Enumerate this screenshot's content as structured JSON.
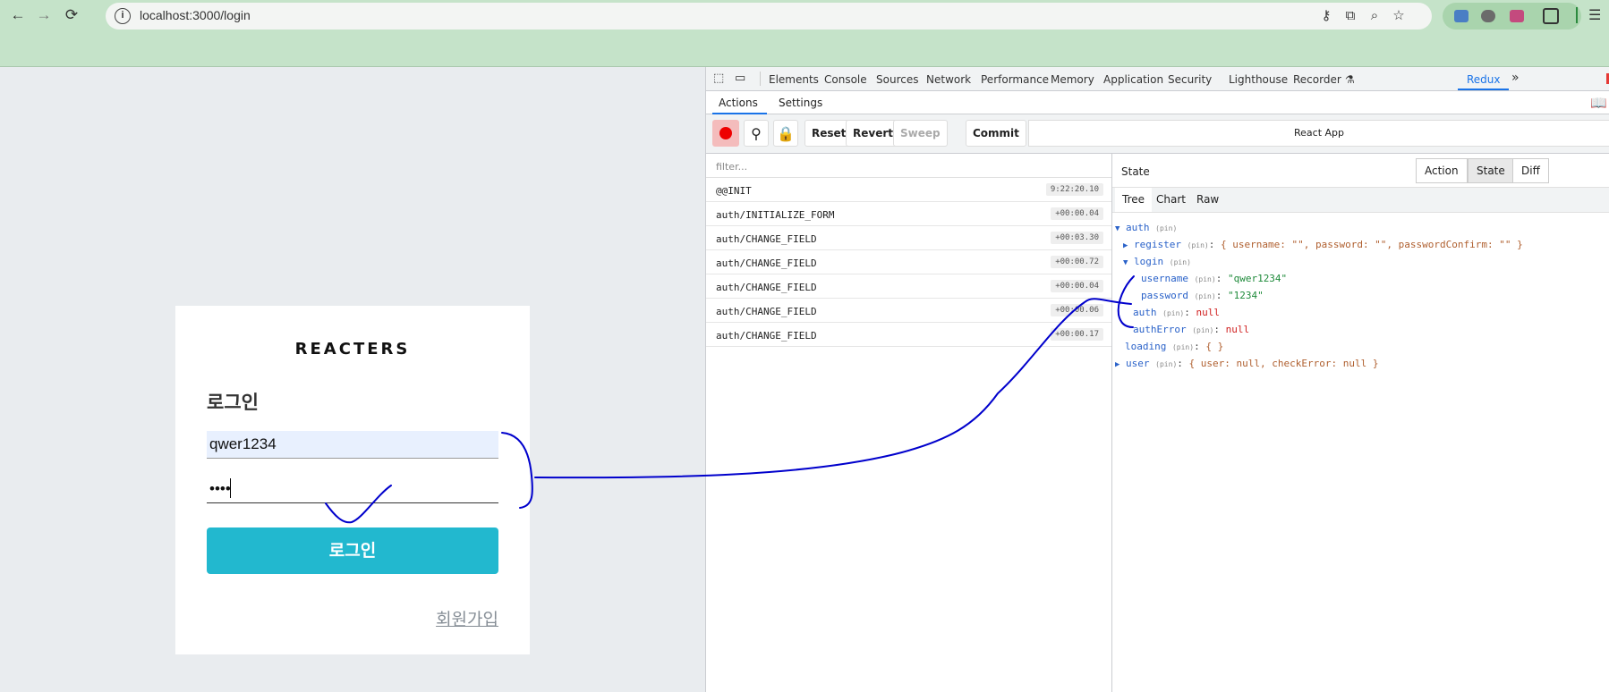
{
  "browser": {
    "url": "localhost:3000/login",
    "info_glyph": "i"
  },
  "login_card": {
    "logo": "REACTERS",
    "heading": "로그인",
    "username_value": "qwer1234",
    "password_value": "••••",
    "submit_label": "로그인",
    "register_link": "회원가입"
  },
  "devtools": {
    "tabs": [
      "Elements",
      "Console",
      "Sources",
      "Network",
      "Performance",
      "Memory",
      "Application",
      "Security",
      "Lighthouse",
      "Recorder",
      "Redux"
    ],
    "active_tab": "Redux",
    "more_glyph": "»",
    "redux": {
      "subtabs": [
        "Actions",
        "Settings"
      ],
      "active_subtab": "Actions",
      "toolbar": {
        "reset": "Reset",
        "revert": "Revert",
        "sweep": "Sweep",
        "commit": "Commit",
        "instance": "React App"
      },
      "filter_placeholder": "filter...",
      "actions": [
        {
          "name": "@@INIT",
          "time": "9:22:20.10"
        },
        {
          "name": "auth/INITIALIZE_FORM",
          "time": "+00:00.04"
        },
        {
          "name": "auth/CHANGE_FIELD",
          "time": "+00:03.30"
        },
        {
          "name": "auth/CHANGE_FIELD",
          "time": "+00:00.72"
        },
        {
          "name": "auth/CHANGE_FIELD",
          "time": "+00:00.04"
        },
        {
          "name": "auth/CHANGE_FIELD",
          "time": "+00:00.06"
        },
        {
          "name": "auth/CHANGE_FIELD",
          "time": "+00:00.17"
        }
      ],
      "state_panel": {
        "title": "State",
        "modes": [
          "Action",
          "State",
          "Diff"
        ],
        "active_mode": "State",
        "views": [
          "Tree",
          "Chart",
          "Raw"
        ],
        "active_view": "Tree",
        "pin_label": "(pin)",
        "tree": {
          "auth_key": "auth",
          "register_key": "register",
          "register_summary": "{ username: \"\", password: \"\", passwordConfirm: \"\" }",
          "login_key": "login",
          "username_key": "username",
          "username_val": "\"qwer1234\"",
          "password_key": "password",
          "password_val": "\"1234\"",
          "auth_inner_key": "auth",
          "auth_inner_val": "null",
          "authError_key": "authError",
          "authError_val": "null",
          "loading_key": "loading",
          "loading_val": "{ }",
          "user_key": "user",
          "user_summary": "{ user: null, checkError: null }"
        }
      }
    }
  },
  "colors": {
    "browser_chrome": "#c5e3c9",
    "page_bg": "#e9ecef",
    "login_button": "#22b8cf",
    "annotation_ink": "#0000cc",
    "devtools_accent": "#1a73e8"
  }
}
